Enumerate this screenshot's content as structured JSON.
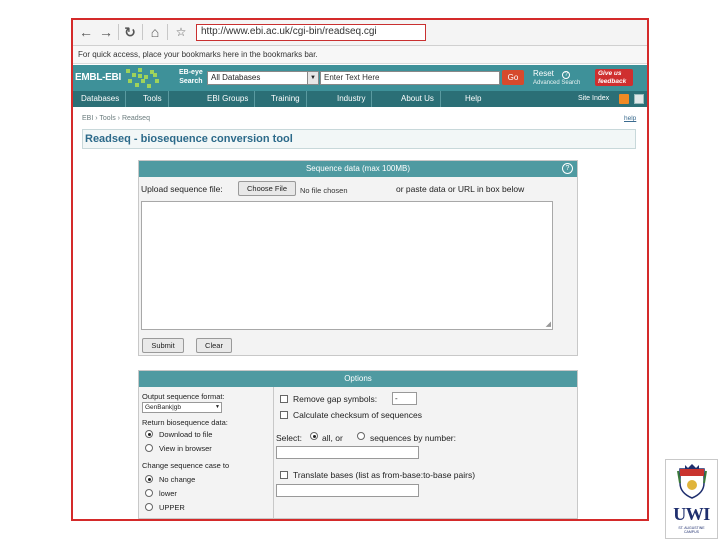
{
  "browser": {
    "url": "http://www.ebi.ac.uk/cgi-bin/readseq.cgi",
    "bookmarks_hint": "For quick access, place your bookmarks here in the bookmarks bar."
  },
  "ebi_header": {
    "logo": "EMBL-EBI",
    "eye_line1": "EB-eye",
    "eye_line2": "Search",
    "database_select": "All Databases",
    "search_placeholder": "Enter Text Here",
    "go_label": "Go",
    "reset_label": "Reset",
    "help_glyph": "?",
    "advanced_search": "Advanced Search",
    "feedback_line1": "Give us",
    "feedback_line2": "feedback"
  },
  "nav": {
    "items": [
      "Databases",
      "Tools",
      "EBI Groups",
      "Training",
      "Industry",
      "About Us",
      "Help"
    ],
    "site_index": "Site Index"
  },
  "page": {
    "breadcrumb": "EBI › Tools › Readseq",
    "help_link": "help",
    "title": "Readseq - biosequence conversion tool"
  },
  "sequence_panel": {
    "header": "Sequence data (max 100MB)",
    "help_glyph": "?",
    "upload_label": "Upload sequence file:",
    "choose_file": "Choose File",
    "no_file": "No file chosen",
    "paste_label": "or paste data or URL in box below",
    "submit": "Submit",
    "clear": "Clear"
  },
  "options_panel": {
    "header": "Options",
    "output_format_label": "Output sequence format:",
    "output_format_value": "GenBank|gb",
    "return_label": "Return biosequence data:",
    "return_options": [
      {
        "label": "Download to file",
        "selected": true
      },
      {
        "label": "View in browser",
        "selected": false
      }
    ],
    "case_label": "Change sequence case to",
    "case_options": [
      {
        "label": "No change",
        "selected": true
      },
      {
        "label": "lower",
        "selected": false
      },
      {
        "label": "UPPER",
        "selected": false
      }
    ],
    "remove_gap_label": "Remove gap symbols:",
    "gap_value": "-",
    "checksum_label": "Calculate checksum of sequences",
    "select_label": "Select:",
    "select_all": "all, or",
    "select_by_number": "sequences by number:",
    "translate_label": "Translate bases (list as from-base:to-base pairs)"
  },
  "crest": {
    "text": "UWI",
    "sub_line1": "ST. AUGUSTINE",
    "sub_line2": "CAMPUS"
  },
  "colors": {
    "frame_border": "#d42a2a",
    "ebi_teal": "#3e9199",
    "nav_teal": "#2b6f76",
    "panel_header": "#4f9aa1",
    "title_blue": "#2c6a8a"
  }
}
